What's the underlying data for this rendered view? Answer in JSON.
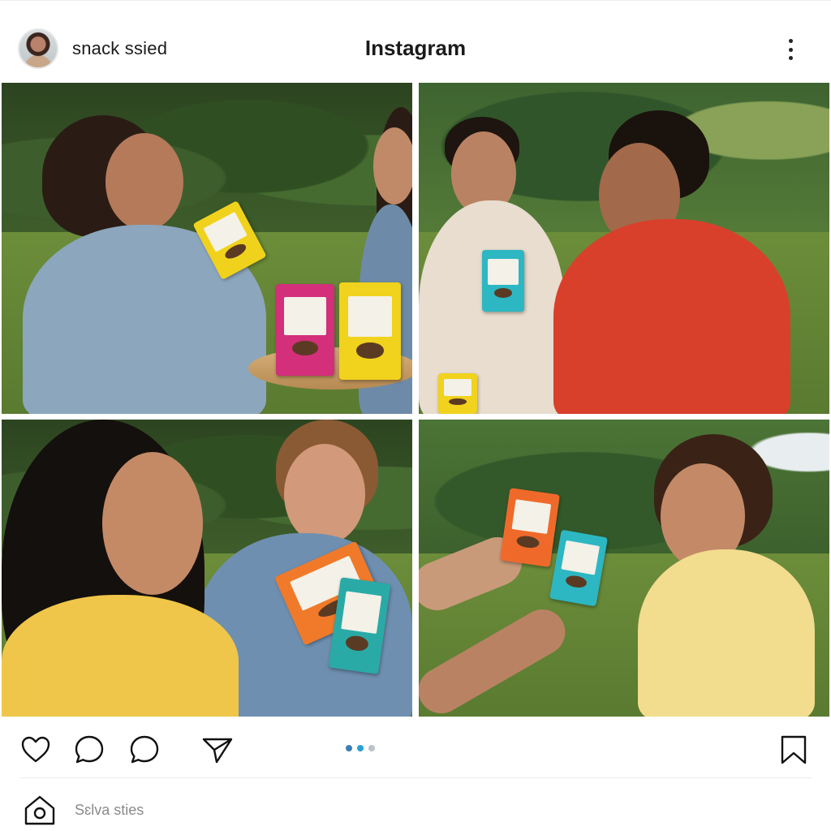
{
  "header": {
    "username": "snack ssied",
    "app_title": "Instagram"
  },
  "post": {
    "photos": [
      {
        "id": "photo-1",
        "description": "two women laughing with snack packs at park table"
      },
      {
        "id": "photo-2",
        "description": "two men laughing on grass holding snack packs"
      },
      {
        "id": "photo-3",
        "description": "woman and man smiling, man holding snack packs"
      },
      {
        "id": "photo-4",
        "description": "man laughing, hands exchanging snack packs"
      }
    ],
    "carousel": {
      "count": 3,
      "active_index": 1
    }
  },
  "actions": {
    "icons": [
      "heart-icon",
      "comment-icon",
      "comment-icon",
      "send-icon",
      "bookmark-icon"
    ]
  },
  "bottom_nav": {
    "label": "Sɛlva sties"
  },
  "colors": {
    "accent": "#2b9fd6",
    "dot_inactive": "#b9c3c9",
    "text_muted": "#8a8a8a"
  }
}
